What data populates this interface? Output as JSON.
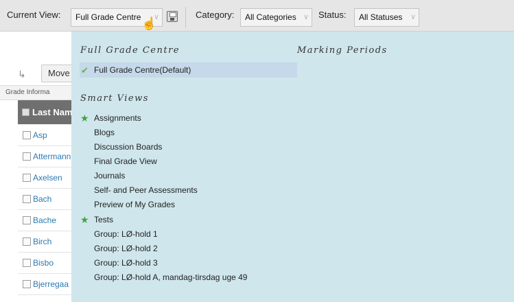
{
  "toolbar": {
    "current_view_label": "Current View:",
    "current_view_value": "Full Grade Centre",
    "category_label": "Category:",
    "category_value": "All Categories",
    "status_label": "Status:",
    "status_value": "All Statuses"
  },
  "grid": {
    "move_label": "Move",
    "grade_info_label": "Grade Informa",
    "last_name_header": "Last Nam",
    "rows": [
      "Asp",
      "Attermann",
      "Axelsen",
      "Bach",
      "Bache",
      "Birch",
      "Bisbo",
      "Bjerregaa"
    ]
  },
  "menu": {
    "full_grade_heading": "Full Grade Centre",
    "marking_periods_heading": "Marking Periods",
    "full_grade_default": "Full Grade Centre(Default)",
    "smart_views_heading": "Smart Views",
    "smart_views": [
      "Assignments",
      "Blogs",
      "Discussion Boards",
      "Final Grade View",
      "Journals",
      "Self- and Peer Assessments",
      "Preview of My Grades",
      "Tests",
      "Group: LØ-hold 1",
      "Group: LØ-hold 2",
      "Group: LØ-hold 3",
      "Group: LØ-hold A, mandag-tirsdag uge 49"
    ]
  },
  "icons": {
    "default_check": "check-icon",
    "favorite": "star-icon",
    "save": "save-icon",
    "pointer": "hand-pointer-icon"
  },
  "colors": {
    "menu_bg": "#cfe6ec",
    "selected_bg": "#c5d9ea",
    "link": "#2b78b0",
    "header_bg": "#6f6f6f"
  }
}
